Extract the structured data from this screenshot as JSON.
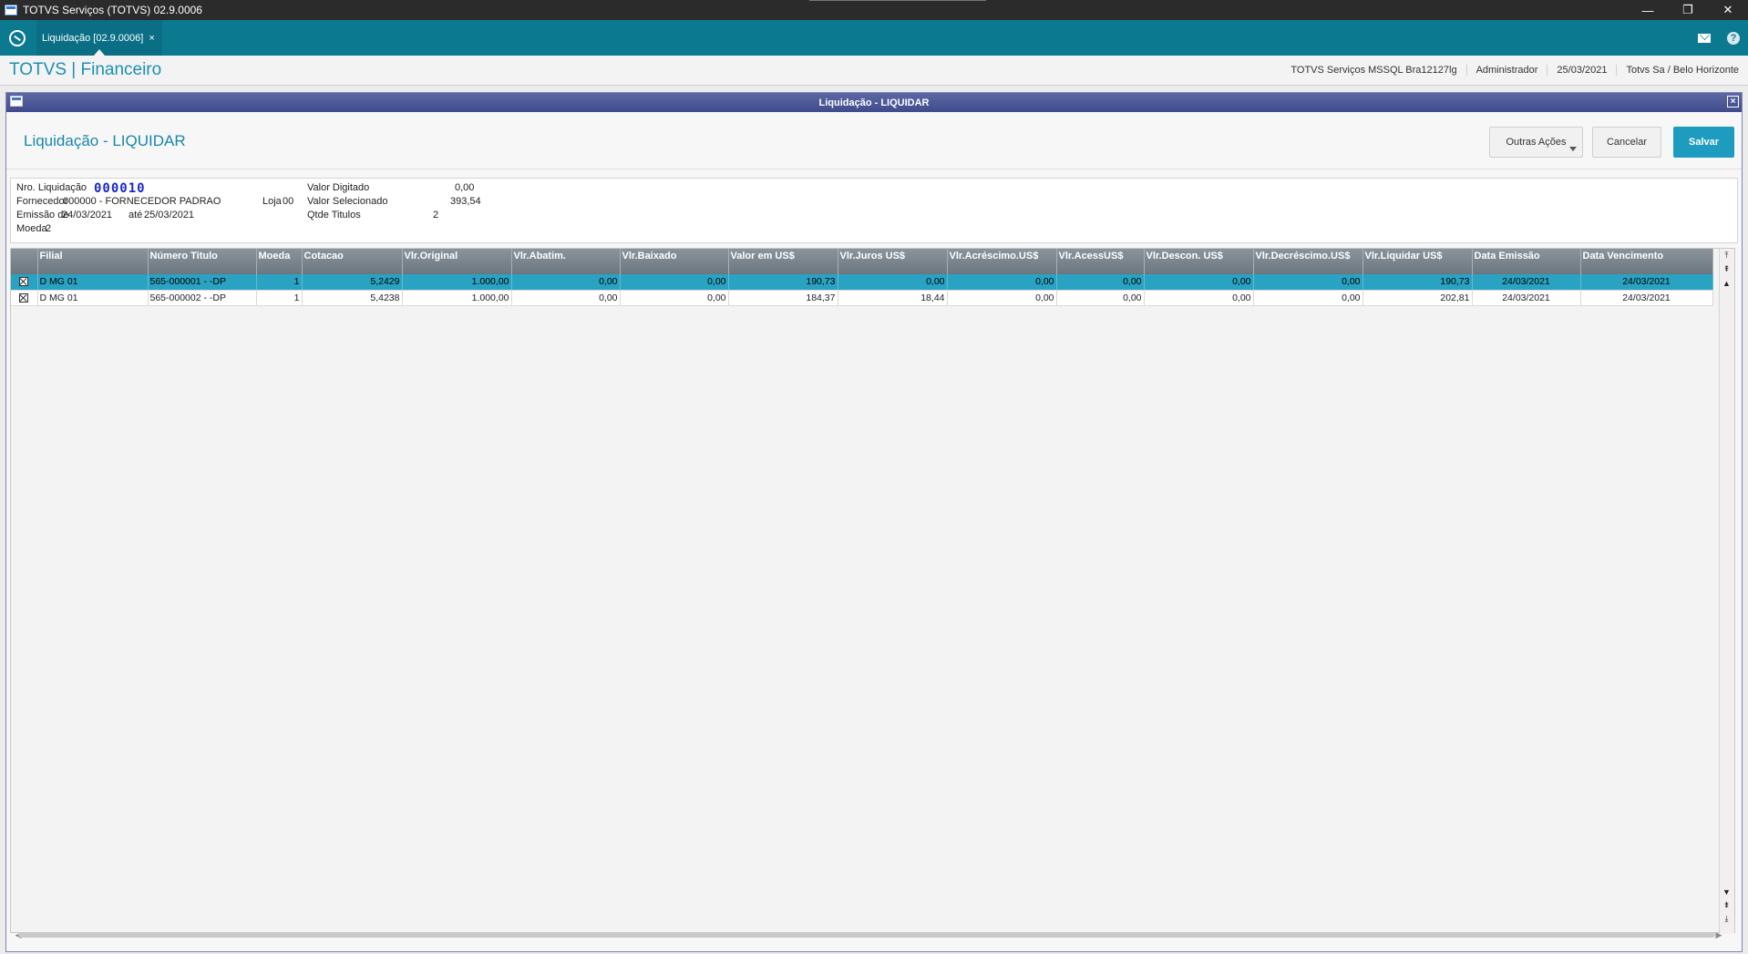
{
  "window": {
    "title": "TOTVS Serviços (TOTVS) 02.9.0006",
    "min": "—",
    "restore": "❐",
    "close": "✕"
  },
  "tabbar": {
    "tab_label": "Liquidação [02.9.0006]",
    "tab_close": "×",
    "help": "?"
  },
  "header": {
    "brand": "TOTVS | Financeiro",
    "environment": "TOTVS Serviços MSSQL Bra12127lg",
    "user": "Administrador",
    "date": "25/03/2021",
    "branch": "Totvs Sa / Belo Horizonte"
  },
  "dialog": {
    "title": "Liquidação - LIQUIDAR",
    "close": "×"
  },
  "form": {
    "title": "Liquidação - LIQUIDAR",
    "buttons": {
      "outras": "Outras Ações",
      "cancel": "Cancelar",
      "save": "Salvar"
    }
  },
  "summary": {
    "nro_label": "Nro. Liquidação",
    "nro_value": "000010",
    "fornecedor_label": "Fornecedor",
    "fornecedor_value": "000000 - FORNECEDOR PADRAO",
    "loja_label": "Loja",
    "loja_value": "00",
    "emissao_label": "Emissão de",
    "emissao_de": "24/03/2021",
    "ate_label": "até",
    "emissao_ate": "25/03/2021",
    "moeda_label": "Moeda",
    "moeda_value": "2",
    "valor_digitado_label": "Valor Digitado",
    "valor_digitado": "0,00",
    "valor_selecionado_label": "Valor Selecionado",
    "valor_selecionado": "393,54",
    "qtde_label": "Qtde Titulos",
    "qtde_value": "2"
  },
  "grid": {
    "columns": [
      "",
      "Filial",
      "Número Titulo",
      "Moeda",
      "Cotacao",
      "Vlr.Original",
      "Vlr.Abatim.",
      "Vlr.Baixado",
      "Valor em US$",
      "Vlr.Juros US$",
      "Vlr.Acréscimo.US$",
      "Vlr.AcessUS$",
      "Vlr.Descon. US$",
      "Vlr.Decréscimo.US$",
      "Vlr.Liquidar US$",
      "Data Emissão",
      "Data Vencimento"
    ],
    "rows": [
      [
        "",
        "D MG 01",
        "565-000001   -  -DP",
        "1",
        "5,2429",
        "1.000,00",
        "0,00",
        "0,00",
        "190,73",
        "0,00",
        "0,00",
        "0,00",
        "0,00",
        "0,00",
        "190,73",
        "24/03/2021",
        "24/03/2021"
      ],
      [
        "",
        "D MG 01",
        "565-000002   -  -DP",
        "1",
        "5,4238",
        "1.000,00",
        "0,00",
        "0,00",
        "184,37",
        "18,44",
        "0,00",
        "0,00",
        "0,00",
        "0,00",
        "202,81",
        "24/03/2021",
        "24/03/2021"
      ]
    ],
    "selected_row": 0
  }
}
